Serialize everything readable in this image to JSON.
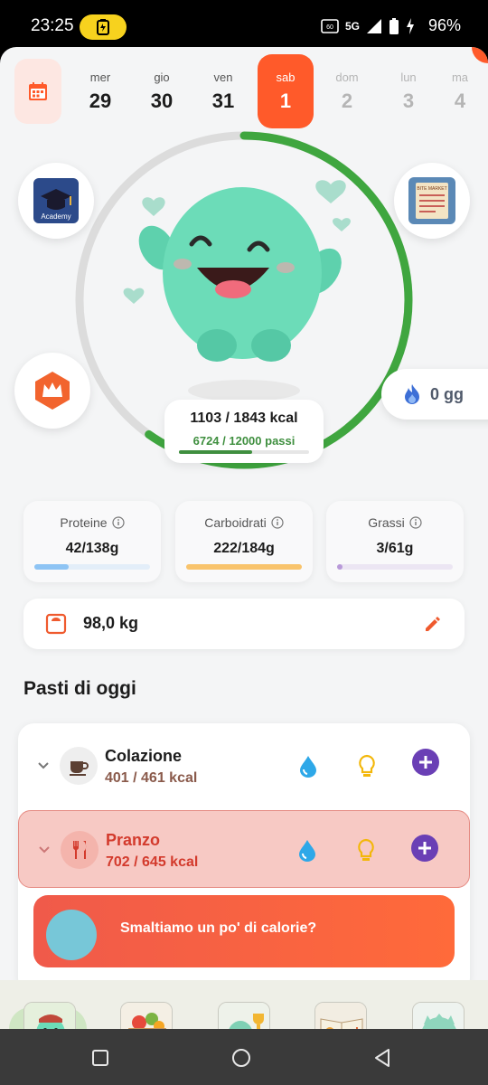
{
  "status_bar": {
    "time": "23:25",
    "battery_pct": "96%",
    "network": "5G"
  },
  "calendar": {
    "days": [
      {
        "name": "mer",
        "num": "29"
      },
      {
        "name": "gio",
        "num": "30"
      },
      {
        "name": "ven",
        "num": "31"
      },
      {
        "name": "sab",
        "num": "1"
      },
      {
        "name": "dom",
        "num": "2"
      },
      {
        "name": "lun",
        "num": "3"
      },
      {
        "name": "ma",
        "num": "4"
      }
    ],
    "active_index": 3
  },
  "progress": {
    "kcal_text": "1103 / 1843 kcal",
    "steps_text": "6724 / 12000 passi",
    "kcal_fraction": 0.598,
    "steps_fraction": 0.56
  },
  "side": {
    "academy_label": "Academy",
    "market_label": "BITE MARKET",
    "streak_text": "0 gg"
  },
  "macros": [
    {
      "label": "Proteine",
      "value": "42/138g",
      "fraction": 0.3,
      "color": "#8ec4f4"
    },
    {
      "label": "Carboidrati",
      "value": "222/184g",
      "fraction": 1.0,
      "color": "#f9c46c"
    },
    {
      "label": "Grassi",
      "value": "3/61g",
      "fraction": 0.05,
      "color": "#b99ad9"
    }
  ],
  "weight": {
    "value": "98,0 kg"
  },
  "meals_section": {
    "title": "Pasti di oggi",
    "meals": [
      {
        "name": "Colazione",
        "kcal": "401 / 461 kcal"
      },
      {
        "name": "Pranzo",
        "kcal": "702 / 645 kcal"
      }
    ],
    "promo": "Smaltiamo un po' di calorie?"
  },
  "colors": {
    "accent": "#ff5a2a",
    "ring_progress": "#3fa63f",
    "ring_track": "#dcdcdc",
    "add_button": "#6a3fb5"
  }
}
